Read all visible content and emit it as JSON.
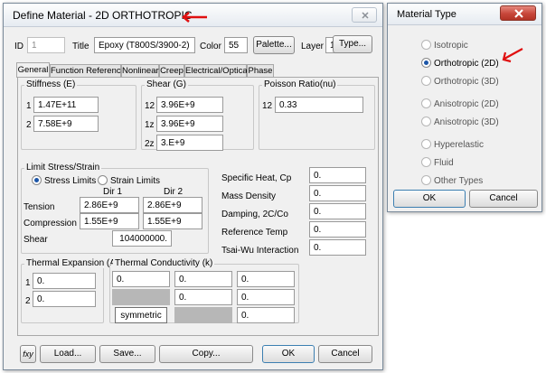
{
  "define_material": {
    "title": "Define Material - 2D ORTHOTROPIC",
    "arrow_color": "#e01010",
    "id_label": "ID",
    "id_value": "1",
    "title_label": "Title",
    "title_value": "Epoxy (T800S/3900-2)",
    "color_label": "Color",
    "color_value": "55",
    "palette_label": "Palette...",
    "layer_label": "Layer",
    "layer_value": "1",
    "type_label": "Type...",
    "tabs": [
      "General",
      "Function References",
      "Nonlinear",
      "Creep",
      "Electrical/Optical",
      "Phase"
    ],
    "stiffness": {
      "label": "Stiffness (E)",
      "rows": [
        {
          "key": "1",
          "value": "1.47E+11"
        },
        {
          "key": "2",
          "value": "7.58E+9"
        }
      ]
    },
    "shear": {
      "label": "Shear (G)",
      "rows": [
        {
          "key": "12",
          "value": "3.96E+9"
        },
        {
          "key": "1z",
          "value": "3.96E+9"
        },
        {
          "key": "2z",
          "value": "3.E+9"
        }
      ]
    },
    "poisson": {
      "label": "Poisson Ratio(nu)",
      "key": "12",
      "value": "0.33"
    },
    "limit": {
      "label": "Limit Stress/Strain",
      "stress_limits": "Stress Limits",
      "strain_limits": "Strain Limits",
      "dir1": "Dir 1",
      "dir2": "Dir 2",
      "tension_label": "Tension",
      "tension": [
        "2.86E+9",
        "2.86E+9"
      ],
      "compression_label": "Compression",
      "compression": [
        "1.55E+9",
        "1.55E+9"
      ],
      "shear_label": "Shear",
      "shear_value": "104000000."
    },
    "props": [
      {
        "label": "Specific Heat, Cp",
        "value": "0."
      },
      {
        "label": "Mass Density",
        "value": "0."
      },
      {
        "label": "Damping, 2C/Co",
        "value": "0."
      },
      {
        "label": "Reference Temp",
        "value": "0."
      },
      {
        "label": "Tsai-Wu Interaction",
        "value": "0."
      }
    ],
    "thermal_expansion": {
      "label": "Thermal Expansion (A)",
      "rows": [
        {
          "key": "1",
          "value": "0."
        },
        {
          "key": "2",
          "value": "0."
        }
      ]
    },
    "thermal_conductivity": {
      "label": "Thermal Conductivity (k)",
      "row1": [
        "0.",
        "0.",
        "0."
      ],
      "row2": [
        "0.",
        "0."
      ],
      "row3": "0.",
      "symmetric": "symmetric"
    },
    "buttons": {
      "fxy": "fxy",
      "load": "Load...",
      "save": "Save...",
      "copy": "Copy...",
      "ok": "OK",
      "cancel": "Cancel"
    },
    "close_icon": "close-x-icon"
  },
  "material_type": {
    "title": "Material Type",
    "close_color": "#c7463a",
    "options": [
      {
        "label": "Isotropic",
        "selected": false
      },
      {
        "label": "Orthotropic (2D)",
        "selected": true
      },
      {
        "label": "Orthotropic (3D)",
        "selected": false
      },
      {
        "label": "Anisotropic (2D)",
        "selected": false
      },
      {
        "label": "Anisotropic (3D)",
        "selected": false
      },
      {
        "label": "Hyperelastic",
        "selected": false
      },
      {
        "label": "Fluid",
        "selected": false
      },
      {
        "label": "Other Types",
        "selected": false
      }
    ],
    "ok": "OK",
    "cancel": "Cancel"
  }
}
